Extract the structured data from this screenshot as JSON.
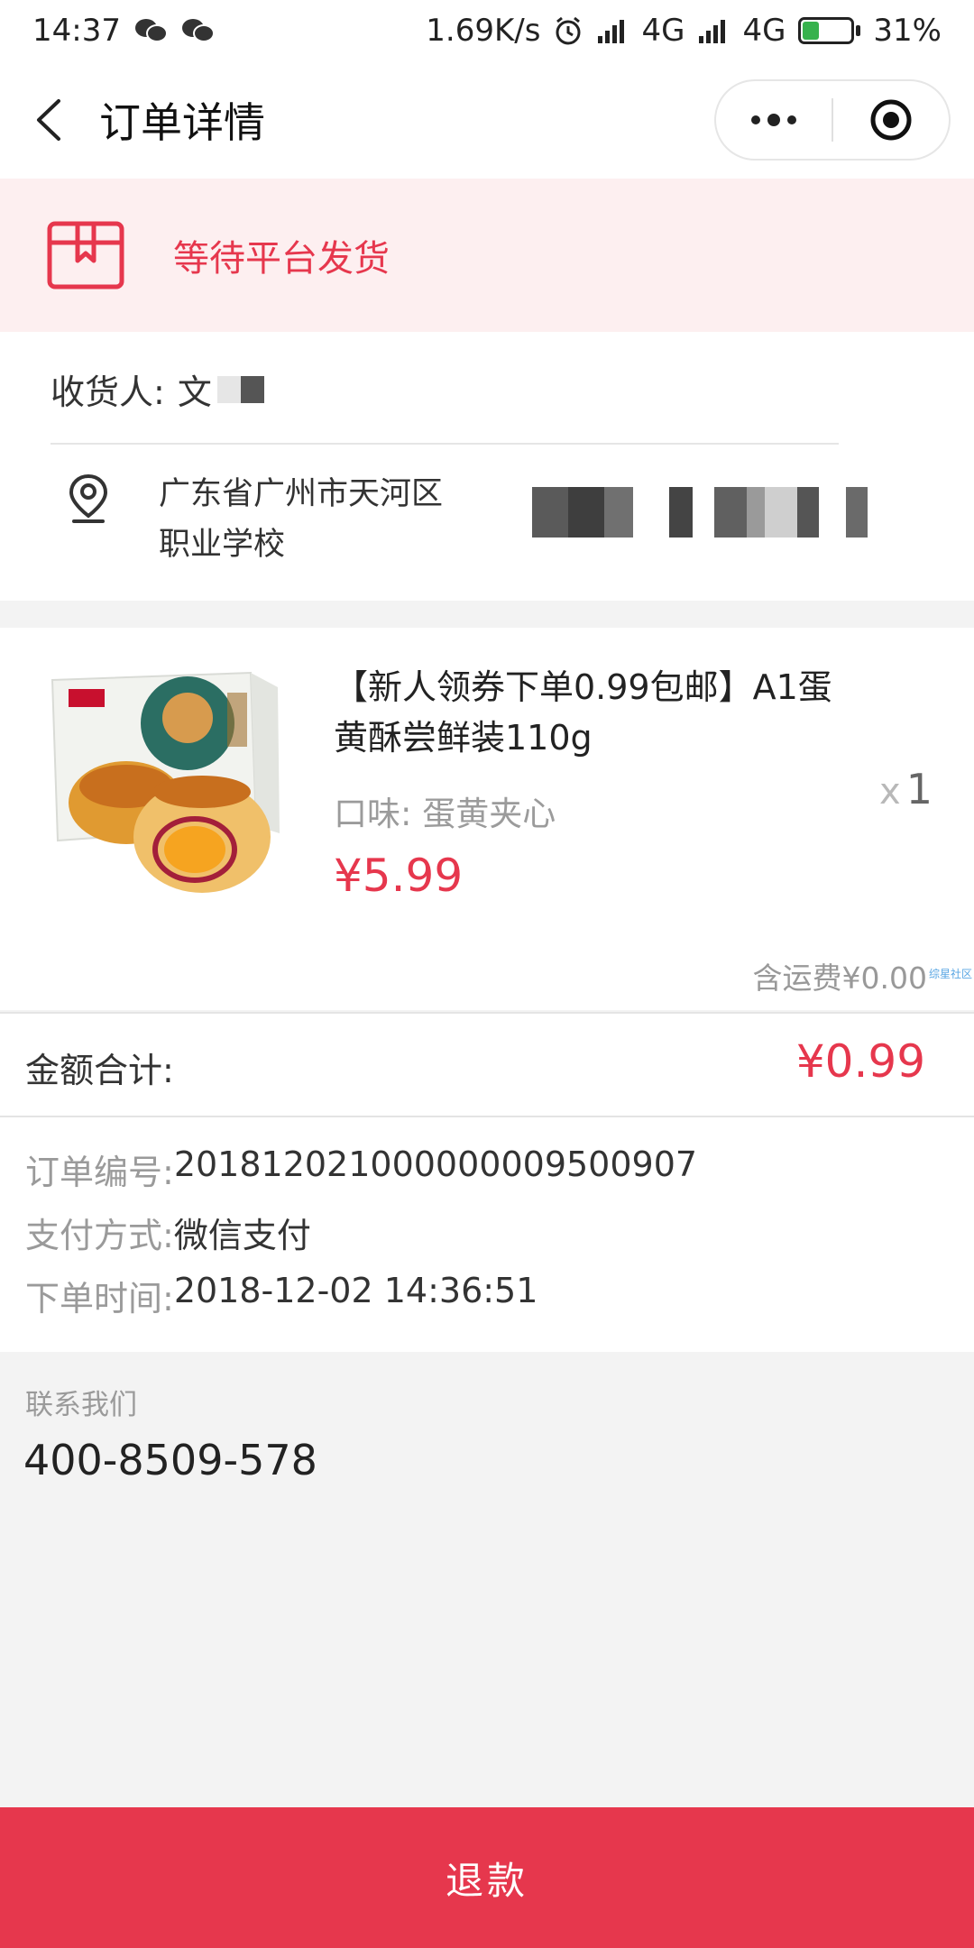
{
  "status_bar": {
    "time": "14:37",
    "net_speed": "1.69K/s",
    "net1": "4G",
    "net2": "4G",
    "battery": "31%",
    "battery_level": 0.31
  },
  "nav": {
    "title": "订单详情"
  },
  "banner": {
    "status": "等待平台发货",
    "accent_color": "#e6374d"
  },
  "address": {
    "receiver_label": "收货人:",
    "receiver_name": "文",
    "line1": "广东省广州市天河区",
    "line2": "职业学校"
  },
  "product": {
    "title": "【新人领券下单0.99包邮】A1蛋黄酥尝鲜装110g",
    "spec": "口味: 蛋黄夹心",
    "price": "¥5.99",
    "qty_x": "x",
    "qty": "1",
    "shipping": "含运费¥0.00",
    "watermark": "综星社区"
  },
  "total": {
    "label": "金额合计:",
    "value": "¥0.99"
  },
  "order_info": {
    "order_no_label": "订单编号:",
    "order_no": "20181202100000000950090​7",
    "pay_label": "支付方式:",
    "pay_method": "微信支付",
    "time_label": "下单时间:",
    "time": "2018-12-02 14:36:51"
  },
  "contact": {
    "label": "联系我们",
    "phone": "400-8509-578"
  },
  "actions": {
    "refund": "退款"
  }
}
